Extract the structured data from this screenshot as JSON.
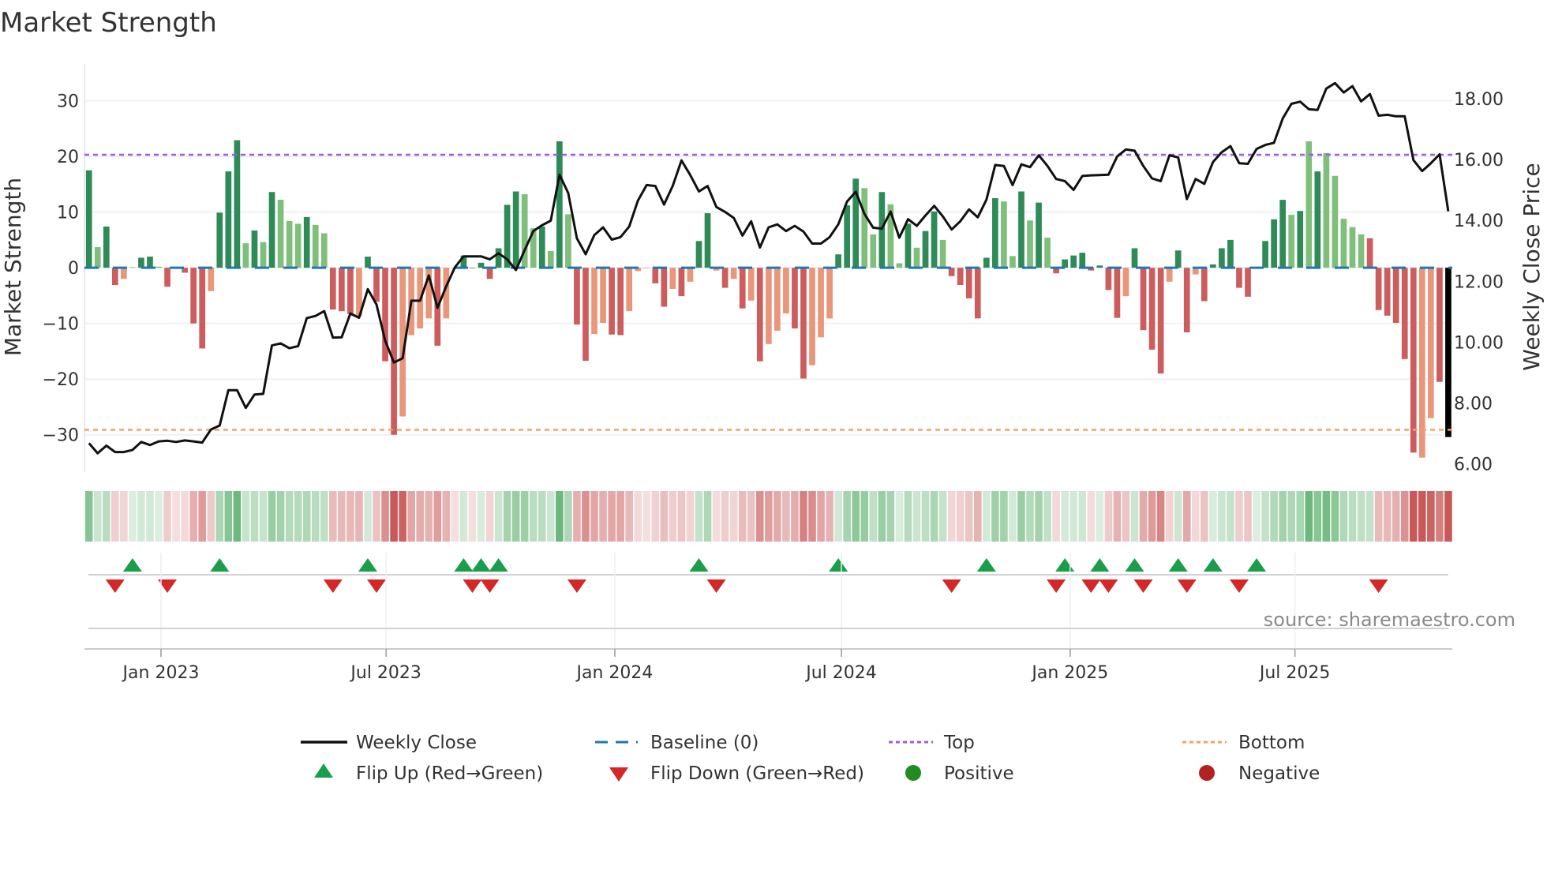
{
  "title": "Market Strength",
  "source": "source: sharemaestro.com",
  "colors": {
    "strong_green": "#2e8b57",
    "weak_green": "#7fbf7b",
    "strong_red": "#cd5c5c",
    "weak_red": "#e9967a",
    "baseline": "#1f77b4",
    "top": "#9b5de5",
    "bottom": "#f4a261",
    "flip_up": "#1a9e4a",
    "flip_down": "#d62728",
    "positive": "#228b22",
    "negative": "#b22222",
    "line": "#111111"
  },
  "legend": {
    "weekly_close": "Weekly Close",
    "baseline": "Baseline (0)",
    "top": "Top",
    "bottom": "Bottom",
    "flip_up": "Flip Up (Red→Green)",
    "flip_down": "Flip Down (Green→Red)",
    "positive": "Positive",
    "negative": "Negative"
  },
  "chart_data": {
    "type": "bar",
    "title": "Market Strength",
    "ylabel": "Market Strength",
    "y2label": "Weekly Close Price",
    "ylim": [
      -36.7,
      36.6
    ],
    "y2lim": [
      5.73,
      19.14
    ],
    "yticks": [
      {
        "v": -30,
        "label": "−30"
      },
      {
        "v": -20,
        "label": "−20"
      },
      {
        "v": -10,
        "label": "−10"
      },
      {
        "v": 0,
        "label": "0"
      },
      {
        "v": 10,
        "label": "10"
      },
      {
        "v": 20,
        "label": "20"
      },
      {
        "v": 30,
        "label": "30"
      }
    ],
    "y2ticks": [
      {
        "v": 6,
        "label": "6.00"
      },
      {
        "v": 8,
        "label": "8.00"
      },
      {
        "v": 10,
        "label": "10.00"
      },
      {
        "v": 12,
        "label": "12.00"
      },
      {
        "v": 14,
        "label": "14.00"
      },
      {
        "v": 16,
        "label": "16.00"
      },
      {
        "v": 18,
        "label": "18.00"
      }
    ],
    "xticks": [
      {
        "week": 9.27,
        "label": "Jan 2023"
      },
      {
        "week": 35.1,
        "label": "Jul 2023"
      },
      {
        "week": 61.35,
        "label": "Jan 2024"
      },
      {
        "week": 87.35,
        "label": "Jul 2024"
      },
      {
        "week": 113.6,
        "label": "Jan 2025"
      },
      {
        "week": 139.4,
        "label": "Jul 2025"
      }
    ],
    "top_level": 20.3,
    "bottom_level": -29.1,
    "series": [
      {
        "name": "Market Strength",
        "values": [
          17.5,
          3.7,
          7.4,
          -3.1,
          -2.0,
          0.1,
          1.8,
          2.0,
          0.2,
          -3.4,
          -0.1,
          -0.9,
          -10,
          -14.5,
          -4.2,
          9.9,
          17.3,
          22.9,
          4.4,
          6.7,
          4.6,
          13.6,
          12.2,
          8.4,
          7.9,
          9.1,
          7.7,
          6.2,
          -7.5,
          -7.8,
          -8.3,
          -8.7,
          2.0,
          -6.1,
          -16.8,
          -30,
          -26.7,
          -12.1,
          -10.9,
          -9.1,
          -14,
          -9.1,
          -0.1,
          2.2,
          -0.1,
          0.9,
          -2.0,
          3.5,
          11.3,
          13.7,
          13.2,
          7.1,
          7.4,
          3.0,
          22.7,
          9.6,
          -10.2,
          -16.7,
          -11.9,
          -9.9,
          -12,
          -12.1,
          -7.8,
          -0.6,
          -0.1,
          -2.8,
          -7,
          -3.8,
          -5.1,
          -2.5,
          4.8,
          9.8,
          -0.5,
          -3.6,
          -2.0,
          -7.3,
          -5.9,
          -16.8,
          -13.7,
          -11.3,
          -8.2,
          -10.9,
          -19.9,
          -17.5,
          -12.5,
          -9.1,
          2.4,
          11.2,
          16.0,
          14.3,
          6.0,
          13.6,
          11.4,
          0.8,
          7.9,
          3.6,
          6.6,
          10.1,
          5.0,
          -1.5,
          -3.1,
          -5.5,
          -9.1,
          1.8,
          12.5,
          11.9,
          2.1,
          13.7,
          8.5,
          11.7,
          5.4,
          -1.0,
          1.5,
          2.2,
          2.7,
          -0.5,
          0.4,
          -4.0,
          -9.0,
          -5.1,
          3.5,
          -11.2,
          -14.7,
          -19.0,
          -2.5,
          3.1,
          -11.6,
          -1.2,
          -6.0,
          0.6,
          3.5,
          5.0,
          -3.6,
          -5.2,
          0.1,
          4.8,
          8.7,
          12.2,
          9.5,
          10.2,
          22.7,
          17.3,
          20.6,
          16.5,
          8.8,
          7.3,
          6.0,
          5.3,
          -7.6,
          -8.6,
          -9.9,
          -16.4,
          -33.2,
          -34.1,
          -27.0,
          -20.5,
          -30.4
        ],
        "shade": "GgGRrgGGgRRRRRrGGGgGgGgggGggRRRrGRRRrrrrRrrGRGRGGGggGgGgRRrrRRrrrRRrRrGGrRrRrRrrrRRrrrGGGggGggGgGGgRRRRGGggGgGgRGGGRGRRrGRRRrGRrRGGGRRGGGGgGgGgggggRRRRRRrrR"
      },
      {
        "name": "Weekly Close",
        "values": [
          6.68,
          6.35,
          6.6,
          6.39,
          6.39,
          6.46,
          6.72,
          6.62,
          6.74,
          6.76,
          6.72,
          6.77,
          6.74,
          6.7,
          7.13,
          7.26,
          8.42,
          8.42,
          7.84,
          8.28,
          8.3,
          9.89,
          9.96,
          9.8,
          9.87,
          10.79,
          10.86,
          11.02,
          10.15,
          10.16,
          10.94,
          10.8,
          11.74,
          11.24,
          10.04,
          9.33,
          9.47,
          11.36,
          11.36,
          12.19,
          11.13,
          11.83,
          12.46,
          12.82,
          12.82,
          12.82,
          12.72,
          12.92,
          12.72,
          12.37,
          13.02,
          13.65,
          13.84,
          13.99,
          15.5,
          14.9,
          13.41,
          12.89,
          13.52,
          13.77,
          13.37,
          13.45,
          13.8,
          14.65,
          15.16,
          15.13,
          14.52,
          15.14,
          15.97,
          15.49,
          14.95,
          15.13,
          14.44,
          14.28,
          14.08,
          13.5,
          13.97,
          13.11,
          13.77,
          13.87,
          13.65,
          13.82,
          13.63,
          13.24,
          13.24,
          13.45,
          13.87,
          14.62,
          14.94,
          14.21,
          13.76,
          13.73,
          14.29,
          13.43,
          14.04,
          13.82,
          14.16,
          14.48,
          14.13,
          13.7,
          13.97,
          14.36,
          14.1,
          14.68,
          15.82,
          15.79,
          15.16,
          15.84,
          15.75,
          16.14,
          15.79,
          15.36,
          15.29,
          15.0,
          15.46,
          15.48,
          15.49,
          15.5,
          16.1,
          16.33,
          16.29,
          15.79,
          15.38,
          15.29,
          16.14,
          16.07,
          14.7,
          15.36,
          15.2,
          15.92,
          16.24,
          16.44,
          15.88,
          15.86,
          16.35,
          16.48,
          16.55,
          17.35,
          17.83,
          17.9,
          17.65,
          17.63,
          18.33,
          18.51,
          18.2,
          18.41,
          17.91,
          18.15,
          17.44,
          17.47,
          17.42,
          17.42,
          15.98,
          15.62,
          15.88,
          16.17,
          14.3
        ]
      }
    ],
    "flip_up_weeks": [
      6,
      16,
      33,
      44,
      46,
      48,
      71,
      87,
      104,
      113,
      117,
      121,
      126,
      130,
      135
    ],
    "flip_down_weeks": [
      4,
      10,
      29,
      34,
      45,
      47,
      57,
      73,
      100,
      112,
      116,
      118,
      122,
      127,
      133,
      149
    ],
    "legend_position": "bottom"
  }
}
